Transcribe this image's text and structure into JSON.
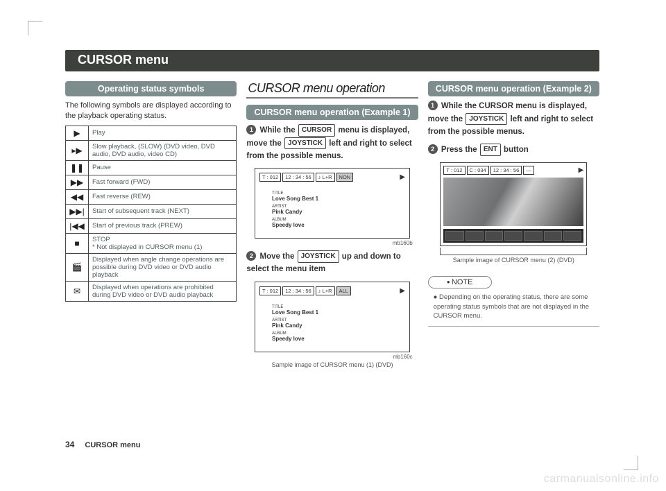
{
  "header": {
    "title": "CURSOR menu"
  },
  "col1": {
    "section_title": "Operating status symbols",
    "intro": "The following symbols are displayed according to the playback operating status.",
    "rows": [
      {
        "icon": "▶",
        "text": "Play"
      },
      {
        "icon": "▸▶",
        "text": "Slow playback, (SLOW) (DVD video, DVD audio, DVD audio, video CD)"
      },
      {
        "icon": "❚❚",
        "text": "Pause"
      },
      {
        "icon": "▶▶",
        "text": "Fast forward (FWD)"
      },
      {
        "icon": "◀◀",
        "text": "Fast reverse (REW)"
      },
      {
        "icon": "▶▶|",
        "text": "Start of subsequent track (NEXT)"
      },
      {
        "icon": "|◀◀",
        "text": "Start of previous track (PREW)"
      },
      {
        "icon": "■",
        "text": "STOP\n* Not displayed in CURSOR menu (1)"
      },
      {
        "icon": "🎬",
        "text": "Displayed when angle change operations are possible during DVD video or DVD audio playback"
      },
      {
        "icon": "✉",
        "text": "Displayed when operations are prohibited during DVD video or DVD audio playback"
      }
    ]
  },
  "col2": {
    "title": "CURSOR menu operation",
    "example_title": "CURSOR menu operation (Example 1)",
    "step1": {
      "a": "While the ",
      "key1": "CURSOR",
      "b": " menu is displayed, move the ",
      "key2": "JOYSTICK",
      "c": " left and right to select from the possible menus."
    },
    "screen1": {
      "t": "T : 012",
      "time": "12 : 34 : 56",
      "ch": "♪ L+R",
      "mode": "NON",
      "tracks": [
        {
          "lbl": "TITLE",
          "name": "Love Song Best 1"
        },
        {
          "lbl": "ARTIST",
          "name": "Pink Candy"
        },
        {
          "lbl": "ALBUM",
          "name": "Speedy love"
        }
      ],
      "caption": "mb160b"
    },
    "step2": {
      "a": "Move the ",
      "key": "JOYSTICK",
      "b": " up and down to select the menu item"
    },
    "screen2": {
      "t": "T : 012",
      "time": "12 : 34 : 56",
      "ch": "♪ L+R",
      "mode": "ALL",
      "tracks": [
        {
          "lbl": "TITLE",
          "name": "Love Song Best 1"
        },
        {
          "lbl": "ARTIST",
          "name": "Pink Candy"
        },
        {
          "lbl": "ALBUM",
          "name": "Speedy love"
        }
      ],
      "caption_code": "mb160c",
      "caption": "Sample image of CURSOR menu (1) (DVD)"
    }
  },
  "col3": {
    "example_title": "CURSOR menu operation (Example 2)",
    "step1": {
      "a": "While the CURSOR menu is displayed, move the ",
      "key": "JOYSTICK",
      "b": " left and right to select from the possible menus."
    },
    "step2": {
      "a": "Press the ",
      "key": "ENT",
      "b": " button"
    },
    "screen": {
      "t": "T : 012",
      "c": "C : 034",
      "time": "12 : 34 : 56",
      "dash": "—",
      "caption": "Sample image of CURSOR menu (2) (DVD)"
    },
    "note_title": "NOTE",
    "note_body": "Depending on the operating status, there are some operating status symbols that are not displayed in the CURSOR menu."
  },
  "footer": {
    "page": "34",
    "section": "CURSOR  menu"
  },
  "watermark": "carmanualsonline.info"
}
